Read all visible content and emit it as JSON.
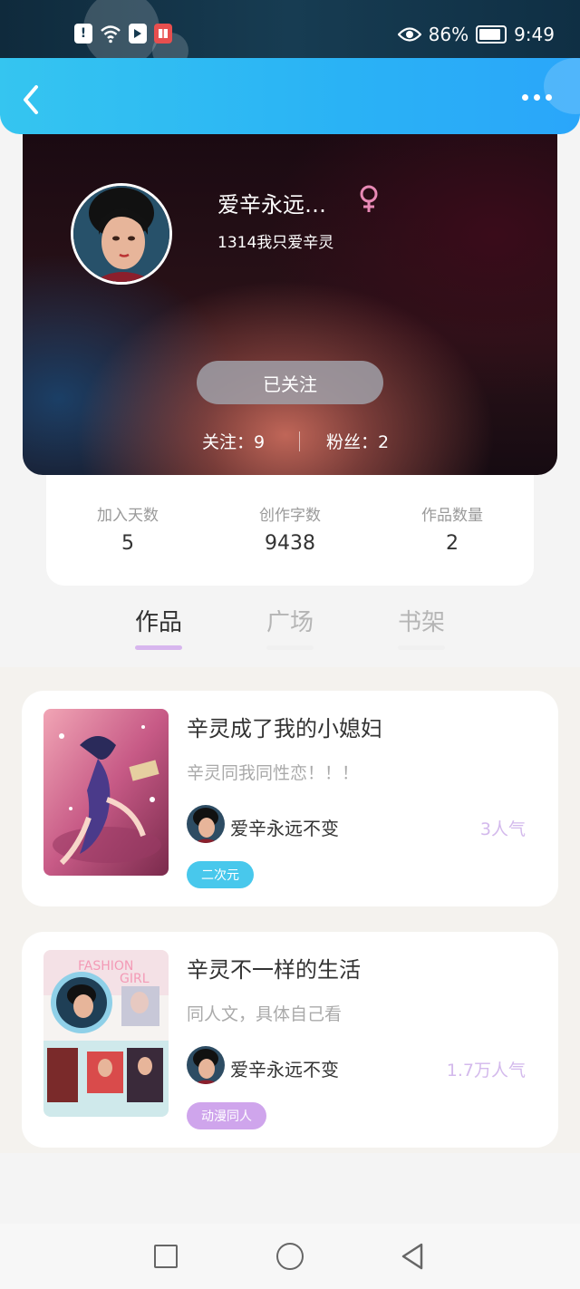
{
  "status_bar": {
    "icons": [
      "alert-icon",
      "wifi-icon",
      "app-icon",
      "book-app-icon"
    ],
    "eye_icon": "eye-icon",
    "battery": "86%",
    "time": "9:49"
  },
  "topnav": {
    "back_icon": "chevron-left-icon",
    "more_icon": "more-dots-icon"
  },
  "profile": {
    "name": "爱辛永远…",
    "gender_icon": "female-icon",
    "gender_color": "#e889b5",
    "signature": "1314我只爱辛灵",
    "follow_button": "已关注",
    "following": "关注：9",
    "fans": "粉丝：2"
  },
  "stats": [
    {
      "label": "加入天数",
      "value": "5"
    },
    {
      "label": "创作字数",
      "value": "9438"
    },
    {
      "label": "作品数量",
      "value": "2"
    }
  ],
  "tabs": [
    {
      "label": "作品",
      "active": true
    },
    {
      "label": "广场",
      "active": false
    },
    {
      "label": "书架",
      "active": false
    }
  ],
  "works": [
    {
      "title": "辛灵成了我的小媳妇",
      "description": "辛灵同我同性恋！！！",
      "author": "爱辛永远不变",
      "popularity": "3人气",
      "tag": "二次元",
      "tag_color": "#48c8ec"
    },
    {
      "title": "辛灵不一样的生活",
      "description": "同人文，具体自己看",
      "author": "爱辛永远不变",
      "popularity": "1.7万人气",
      "tag": "动漫同人",
      "tag_color": "#cfa5ec",
      "cover_text": [
        "FASHION",
        "GIRL"
      ]
    }
  ],
  "colors": {
    "accent_blue": "#2ab2f5",
    "tab_indicator": "#d7b6ee",
    "popularity": "#d3b9ec"
  }
}
